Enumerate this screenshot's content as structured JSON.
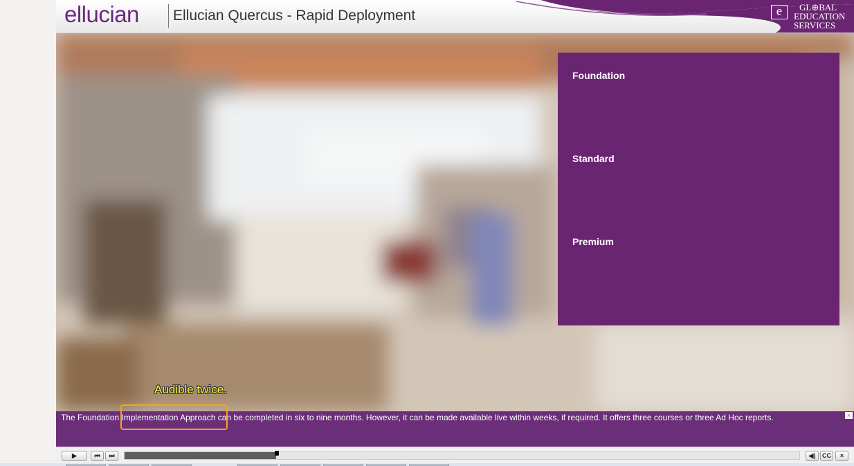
{
  "header": {
    "logo_text": "ellucian",
    "logo_mark": ".",
    "course_title": "Ellucian Quercus - Rapid Deployment",
    "partner_logo": {
      "mark": "e",
      "line1": "GL⊕BAL",
      "line2": "EDUCATION",
      "line3": "SERVICES"
    }
  },
  "menu": {
    "items": [
      {
        "label": "Foundation"
      },
      {
        "label": "Standard"
      },
      {
        "label": "Premium"
      }
    ]
  },
  "annotation": {
    "callout": "Audible twice."
  },
  "caption": {
    "text": "The Foundation Implementation Approach can be completed in six to nine months. However, it can be made available live within weeks, if required. It offers three courses or three Ad Hoc reports.",
    "close_icon": "×"
  },
  "controls": {
    "play": "▶",
    "prev": "⏮",
    "next": "⏭",
    "volume": "◀)",
    "cc": "CC",
    "close": "×",
    "progress": 0.225
  },
  "colors": {
    "brand_purple": "#6a2572",
    "caption_purple": "#6b2e78",
    "callout_yellow": "#fcf43a",
    "highlight_orange": "#f2a61a"
  }
}
